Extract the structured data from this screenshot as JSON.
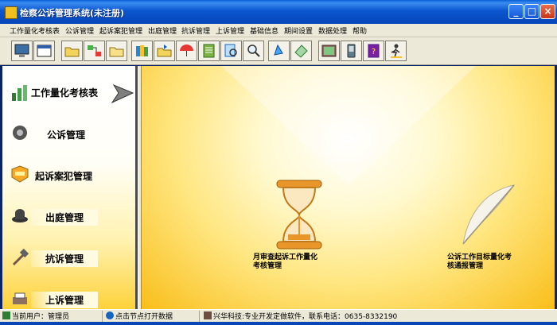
{
  "window": {
    "title": "检察公诉管理系统(未注册)"
  },
  "menu": [
    "工作量化考核表",
    "公诉管理",
    "起诉案犯管理",
    "出庭管理",
    "抗诉管理",
    "上诉管理",
    "基础信息",
    "期间设置",
    "数据处理",
    "帮助"
  ],
  "toolbar_icons": [
    "monitor-icon",
    "window-icon",
    "folder-icon",
    "network-icon",
    "folder-open-icon",
    "books-icon",
    "folder-transfer-icon",
    "umbrella-icon",
    "notebook-icon",
    "search-document-icon",
    "magnifier-icon",
    "bell-icon",
    "tag-icon",
    "picture-icon",
    "palm-device-icon",
    "help-book-icon",
    "exit-person-icon"
  ],
  "sidebar": {
    "items": [
      {
        "label": "工作量化考核表",
        "icon": "bar-chart-icon",
        "active": true
      },
      {
        "label": "公诉管理",
        "icon": "disc-icon"
      },
      {
        "label": "起诉案犯管理",
        "icon": "badge-icon"
      },
      {
        "label": "出庭管理",
        "icon": "hat-icon"
      },
      {
        "label": "抗诉管理",
        "icon": "hammer-icon"
      },
      {
        "label": "上诉管理",
        "icon": "printer-icon"
      }
    ]
  },
  "main": {
    "entries": [
      {
        "label_line1": "月审查起诉工作量化",
        "label_line2": "考核管理",
        "icon": "hourglass-icon"
      },
      {
        "label_line1": "公诉工作目标量化考",
        "label_line2": "核通报管理",
        "icon": "feather-icon"
      }
    ]
  },
  "status": {
    "user": "当前用户：管理员",
    "hint": "点击节点打开数据",
    "vendor": "兴华科技:专业开发定做软件，联系电话：0635-8332190"
  },
  "colors": {
    "title_bar": "#0a56d0",
    "accent_yellow": "#f9be1a",
    "panel": "#ece9d8"
  }
}
